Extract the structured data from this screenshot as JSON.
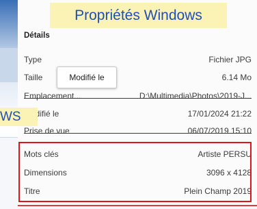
{
  "banner": {
    "title": "Propriétés Windows",
    "side_label": "WS"
  },
  "tooltip": {
    "text": "Modifié le"
  },
  "details": {
    "header": "Détails",
    "rows": [
      {
        "label": "Type",
        "value": "Fichier JPG"
      },
      {
        "label": "Taille",
        "value": "6.14 Mo"
      },
      {
        "label": "Emplacement...",
        "value": "D:\\Multimedia\\Photos\\2019-J..."
      },
      {
        "label": "Modifié le",
        "value": "17/01/2024 21:22"
      },
      {
        "label": "Prise de vue",
        "value": "06/07/2019 15:10"
      },
      {
        "label": "Mots clés",
        "value": "Artiste PERSU"
      },
      {
        "label": "Dimensions",
        "value": "3096 x 4128"
      },
      {
        "label": "Titre",
        "value": "Plein Champ 2019"
      }
    ]
  },
  "colors": {
    "highlight": "#e0141b",
    "banner_bg": "#fbf2b5",
    "banner_text": "#1f4eb7"
  }
}
